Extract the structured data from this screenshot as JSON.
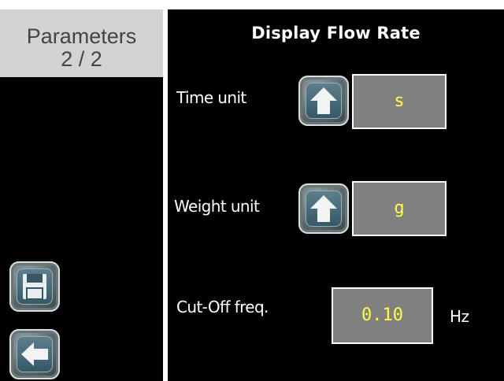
{
  "sidebar": {
    "title": "Parameters",
    "page": "2 / 2"
  },
  "main": {
    "title": "Display Flow Rate",
    "time_unit": {
      "label": "Time unit",
      "value": "s"
    },
    "weight_unit": {
      "label": "Weight unit",
      "value": "g"
    },
    "cutoff": {
      "label": "Cut-Off freq.",
      "value": "0.10",
      "unit": "Hz"
    }
  },
  "icons": {
    "time_unit_button": "up-arrow-icon",
    "weight_unit_button": "up-arrow-icon",
    "save_button": "floppy-disk-icon",
    "back_button": "left-arrow-icon"
  },
  "colors": {
    "background": "#000000",
    "header_bg": "#d3d3d3",
    "value_bg": "#808080",
    "value_text": "#ffff40"
  }
}
